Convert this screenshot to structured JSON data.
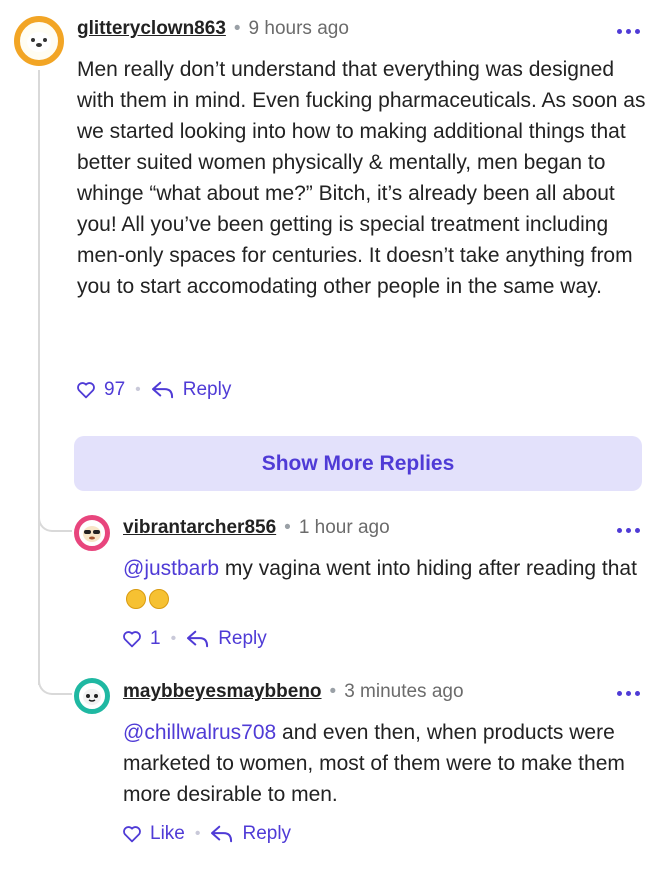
{
  "comment": {
    "username": "glitteryclown863",
    "separator": "•",
    "timestamp": "9 hours ago",
    "text": "Men really don’t understand that everything was designed with them in mind. Even fucking pharmaceuticals. As soon as we started looking into how to making additional things that better suited women physically & mentally, men began to whinge “what about me?” Bitch, it’s already been all about you! All you’ve been getting is special treatment including men-only spaces for centuries. It doesn’t take anything from you to start accomodating other people in the same way.",
    "like_count": "97",
    "reply_label": "Reply"
  },
  "show_more_label": "Show More Replies",
  "replies": [
    {
      "username": "vibrantarcher856",
      "separator": "•",
      "timestamp": "1 hour ago",
      "mention": "@justbarb",
      "text": " my vagina went into hiding after reading that",
      "emojis": [
        "rofl-emoji",
        "grimace-emoji"
      ],
      "like_count": "1",
      "reply_label": "Reply"
    },
    {
      "username": "maybbeyesmaybbeno",
      "separator": "•",
      "timestamp": "3 minutes ago",
      "mention": "@chillwalrus708",
      "text": " and even then, when products were marketed to women, most of them were to make them more desirable to men.",
      "like_label": "Like",
      "reply_label": "Reply"
    }
  ],
  "colors": {
    "accent": "#4f3bd6",
    "show_more_bg": "#e3e1fb",
    "avatar_ring_main": "#f2a525",
    "avatar_ring_r1": "#e8457d",
    "avatar_ring_r2": "#1fb8a2"
  },
  "icons": {
    "like": "heart-outline-icon",
    "reply": "reply-arrow-icon",
    "more": "more-dots-icon"
  }
}
